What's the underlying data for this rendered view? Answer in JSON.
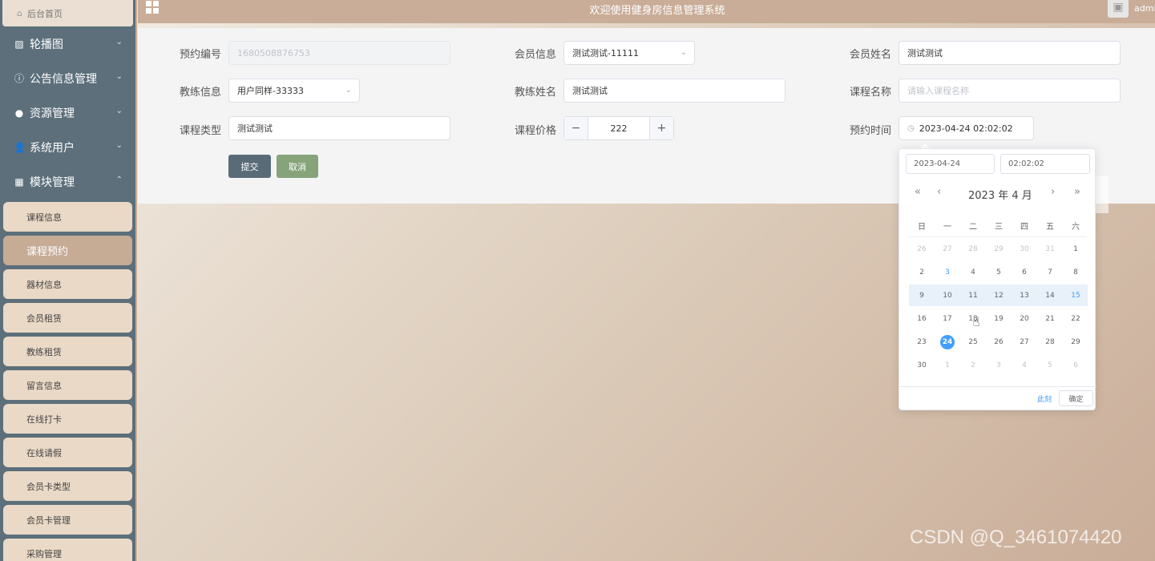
{
  "sidebar": {
    "home": "后台首页",
    "menus": [
      {
        "label": "轮播图",
        "icon": "image-icon",
        "glyph": "▨",
        "arrow": "⌄"
      },
      {
        "label": "公告信息管理",
        "icon": "info-icon",
        "glyph": "ⓘ",
        "arrow": "⌄"
      },
      {
        "label": "资源管理",
        "icon": "bulb-icon",
        "glyph": "●",
        "arrow": "⌄"
      },
      {
        "label": "系统用户",
        "icon": "user-icon",
        "glyph": "👤",
        "arrow": "⌄"
      },
      {
        "label": "模块管理",
        "icon": "grid-icon",
        "glyph": "▦",
        "arrow": "⌃"
      }
    ],
    "sub_items": [
      "课程信息",
      "课程预约",
      "器材信息",
      "会员租赁",
      "教练租赁",
      "留言信息",
      "在线打卡",
      "在线请假",
      "会员卡类型",
      "会员卡管理",
      "采购管理"
    ],
    "active_sub": "课程预约"
  },
  "header": {
    "title": "欢迎使用健身房信息管理系统",
    "user": "admin"
  },
  "form": {
    "booking_no": {
      "label": "预约编号",
      "value": "1680508876753"
    },
    "member_info": {
      "label": "会员信息",
      "value": "测试测试-11111"
    },
    "member_name": {
      "label": "会员姓名",
      "value": "测试测试"
    },
    "coach_info": {
      "label": "教练信息",
      "value": "用户同样-33333"
    },
    "coach_name": {
      "label": "教练姓名",
      "value": "测试测试"
    },
    "course_name": {
      "label": "课程名称",
      "placeholder": "请输入课程名称"
    },
    "course_type": {
      "label": "课程类型",
      "value": "测试测试"
    },
    "course_price": {
      "label": "课程价格",
      "value": "222",
      "minus": "−",
      "plus": "+"
    },
    "booking_time": {
      "label": "预约时间",
      "value": "2023-04-24 02:02:02"
    },
    "submit": "提交",
    "cancel": "取消"
  },
  "picker": {
    "date_value": "2023-04-24",
    "time_value": "02:02:02",
    "prev_year": "«",
    "prev_month": "‹",
    "next_month": "›",
    "next_year": "»",
    "title": "2023 年  4 月",
    "weekdays": [
      "日",
      "一",
      "二",
      "三",
      "四",
      "五",
      "六"
    ],
    "weeks": [
      [
        "26",
        "27",
        "28",
        "29",
        "30",
        "31",
        "1"
      ],
      [
        "2",
        "3",
        "4",
        "5",
        "6",
        "7",
        "8"
      ],
      [
        "9",
        "10",
        "11",
        "12",
        "13",
        "14",
        "15"
      ],
      [
        "16",
        "17",
        "18",
        "19",
        "20",
        "21",
        "22"
      ],
      [
        "23",
        "24",
        "25",
        "26",
        "27",
        "28",
        "29"
      ],
      [
        "30",
        "1",
        "2",
        "3",
        "4",
        "5",
        "6"
      ]
    ],
    "selected": "24",
    "now_label": "此刻",
    "ok_label": "确定"
  },
  "watermark": "CSDN @Q_3461074420",
  "colors": {
    "sidebar": "#5c6f7b",
    "header": "#c9ad98",
    "accent": "#409eff",
    "submit": "#5a6b78",
    "cancel": "#86a37a"
  }
}
